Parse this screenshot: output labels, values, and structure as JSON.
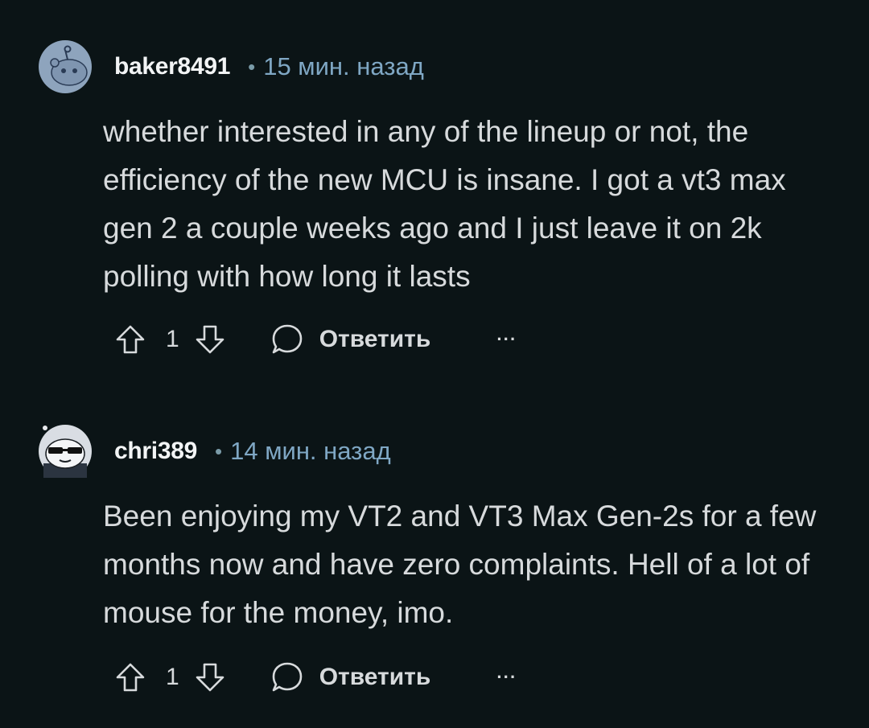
{
  "comments": [
    {
      "username": "baker8491",
      "separator": "•",
      "time": "15 мин. назад",
      "body": "whether interested in any of the lineup or not, the efficiency of the new MCU is insane. I got a vt3 max gen 2 a couple weeks ago and I just leave it on 2k polling with how long it lasts",
      "score": "1",
      "reply_label": "Ответить",
      "more_label": "···"
    },
    {
      "username": "chri389",
      "separator": "•",
      "time": "14 мин. назад",
      "body": "Been enjoying my VT2 and VT3 Max Gen-2s for a few months now and have zero complaints. Hell of a lot of mouse for the money, imo.",
      "score": "1",
      "reply_label": "Ответить",
      "more_label": "···"
    }
  ],
  "colors": {
    "background": "#0b1416",
    "text": "#d7dadc",
    "username": "#f2f4f5",
    "timestamp": "#7fa7c4"
  }
}
